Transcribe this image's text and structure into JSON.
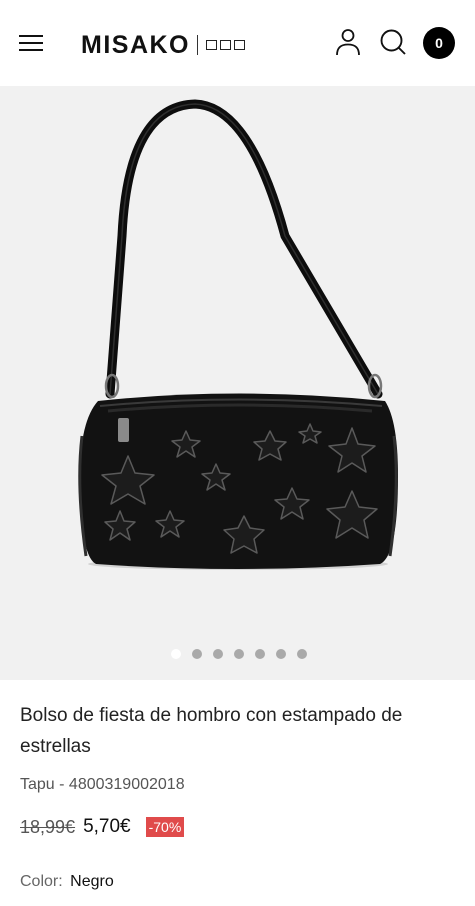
{
  "header": {
    "brand": "MISAKO",
    "cart_count": "0"
  },
  "gallery": {
    "image_alt": "Bolso negro de hombro con estrellas",
    "slide_count": 7,
    "active_slide": 1
  },
  "product": {
    "title": "Bolso de fiesta de hombro con estampado de estrellas",
    "reference": "Tapu - 4800319002018",
    "old_price": "18,99€",
    "price": "5,70€",
    "discount": "-70%",
    "color_label": "Color:",
    "color_value": "Negro"
  },
  "colors": {
    "discount_badge": "#e04b4b",
    "gallery_background": "#f1f1f1",
    "cart_badge": "#000000"
  }
}
